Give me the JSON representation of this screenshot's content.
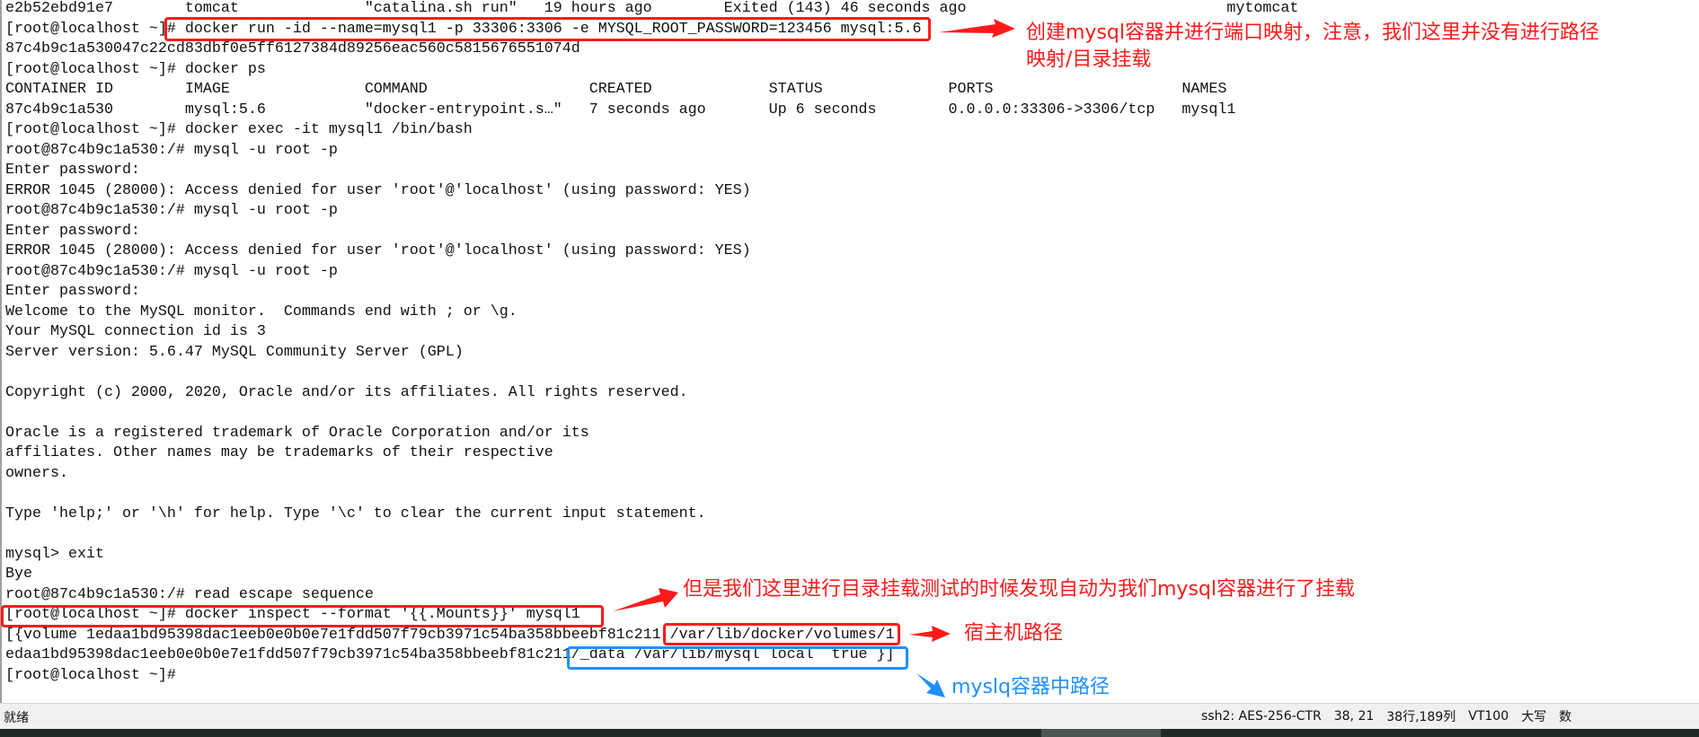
{
  "terminal": {
    "lines": [
      "e2b52ebd91e7        tomcat              \"catalina.sh run\"   19 hours ago        Exited (143) 46 seconds ago                             mytomcat",
      "[root@localhost ~]# docker run -id --name=mysql1 -p 33306:3306 -e MYSQL_ROOT_PASSWORD=123456 mysql:5.6",
      "87c4b9c1a530047c22cd83dbf0e5ff6127384d89256eac560c5815676551074d",
      "[root@localhost ~]# docker ps",
      "CONTAINER ID        IMAGE               COMMAND                  CREATED             STATUS              PORTS                     NAMES",
      "87c4b9c1a530        mysql:5.6           \"docker-entrypoint.s…\"   7 seconds ago       Up 6 seconds        0.0.0.0:33306->3306/tcp   mysql1",
      "[root@localhost ~]# docker exec -it mysql1 /bin/bash",
      "root@87c4b9c1a530:/# mysql -u root -p",
      "Enter password:",
      "ERROR 1045 (28000): Access denied for user 'root'@'localhost' (using password: YES)",
      "root@87c4b9c1a530:/# mysql -u root -p",
      "Enter password:",
      "ERROR 1045 (28000): Access denied for user 'root'@'localhost' (using password: YES)",
      "root@87c4b9c1a530:/# mysql -u root -p",
      "Enter password:",
      "Welcome to the MySQL monitor.  Commands end with ; or \\g.",
      "Your MySQL connection id is 3",
      "Server version: 5.6.47 MySQL Community Server (GPL)",
      "",
      "Copyright (c) 2000, 2020, Oracle and/or its affiliates. All rights reserved.",
      "",
      "Oracle is a registered trademark of Oracle Corporation and/or its",
      "affiliates. Other names may be trademarks of their respective",
      "owners.",
      "",
      "Type 'help;' or '\\h' for help. Type '\\c' to clear the current input statement.",
      "",
      "mysql> exit",
      "Bye",
      "root@87c4b9c1a530:/# read escape sequence",
      "[root@localhost ~]# docker inspect --format '{{.Mounts}}' mysql1",
      "[{volume 1edaa1bd95398dac1eeb0e0b0e7e1fdd507f79cb3971c54ba358bbeebf81c211 /var/lib/docker/volumes/1",
      "edaa1bd95398dac1eeb0e0b0e7e1fdd507f79cb3971c54ba358bbeebf81c211/_data /var/lib/mysql local  true }]",
      "[root@localhost ~]#"
    ]
  },
  "annotations": {
    "note1_line1": "创建mysql容器并进行端口映射，注意，我们这里并没有进行路径",
    "note1_line2": "映射/目录挂载",
    "note2": "但是我们这里进行目录挂载测试的时候发现自动为我们mysql容器进行了挂载",
    "note3": "宿主机路径",
    "note4": "myslq容器中路径",
    "red_color": "#ff1a1a",
    "blue_color": "#1e90ff"
  },
  "statusbar": {
    "left": "就绪",
    "cipher": "ssh2: AES-256-CTR",
    "cursor": "38,  21",
    "size": "38行,189列",
    "emulation": "VT100",
    "caps": "大写",
    "num": "数"
  }
}
